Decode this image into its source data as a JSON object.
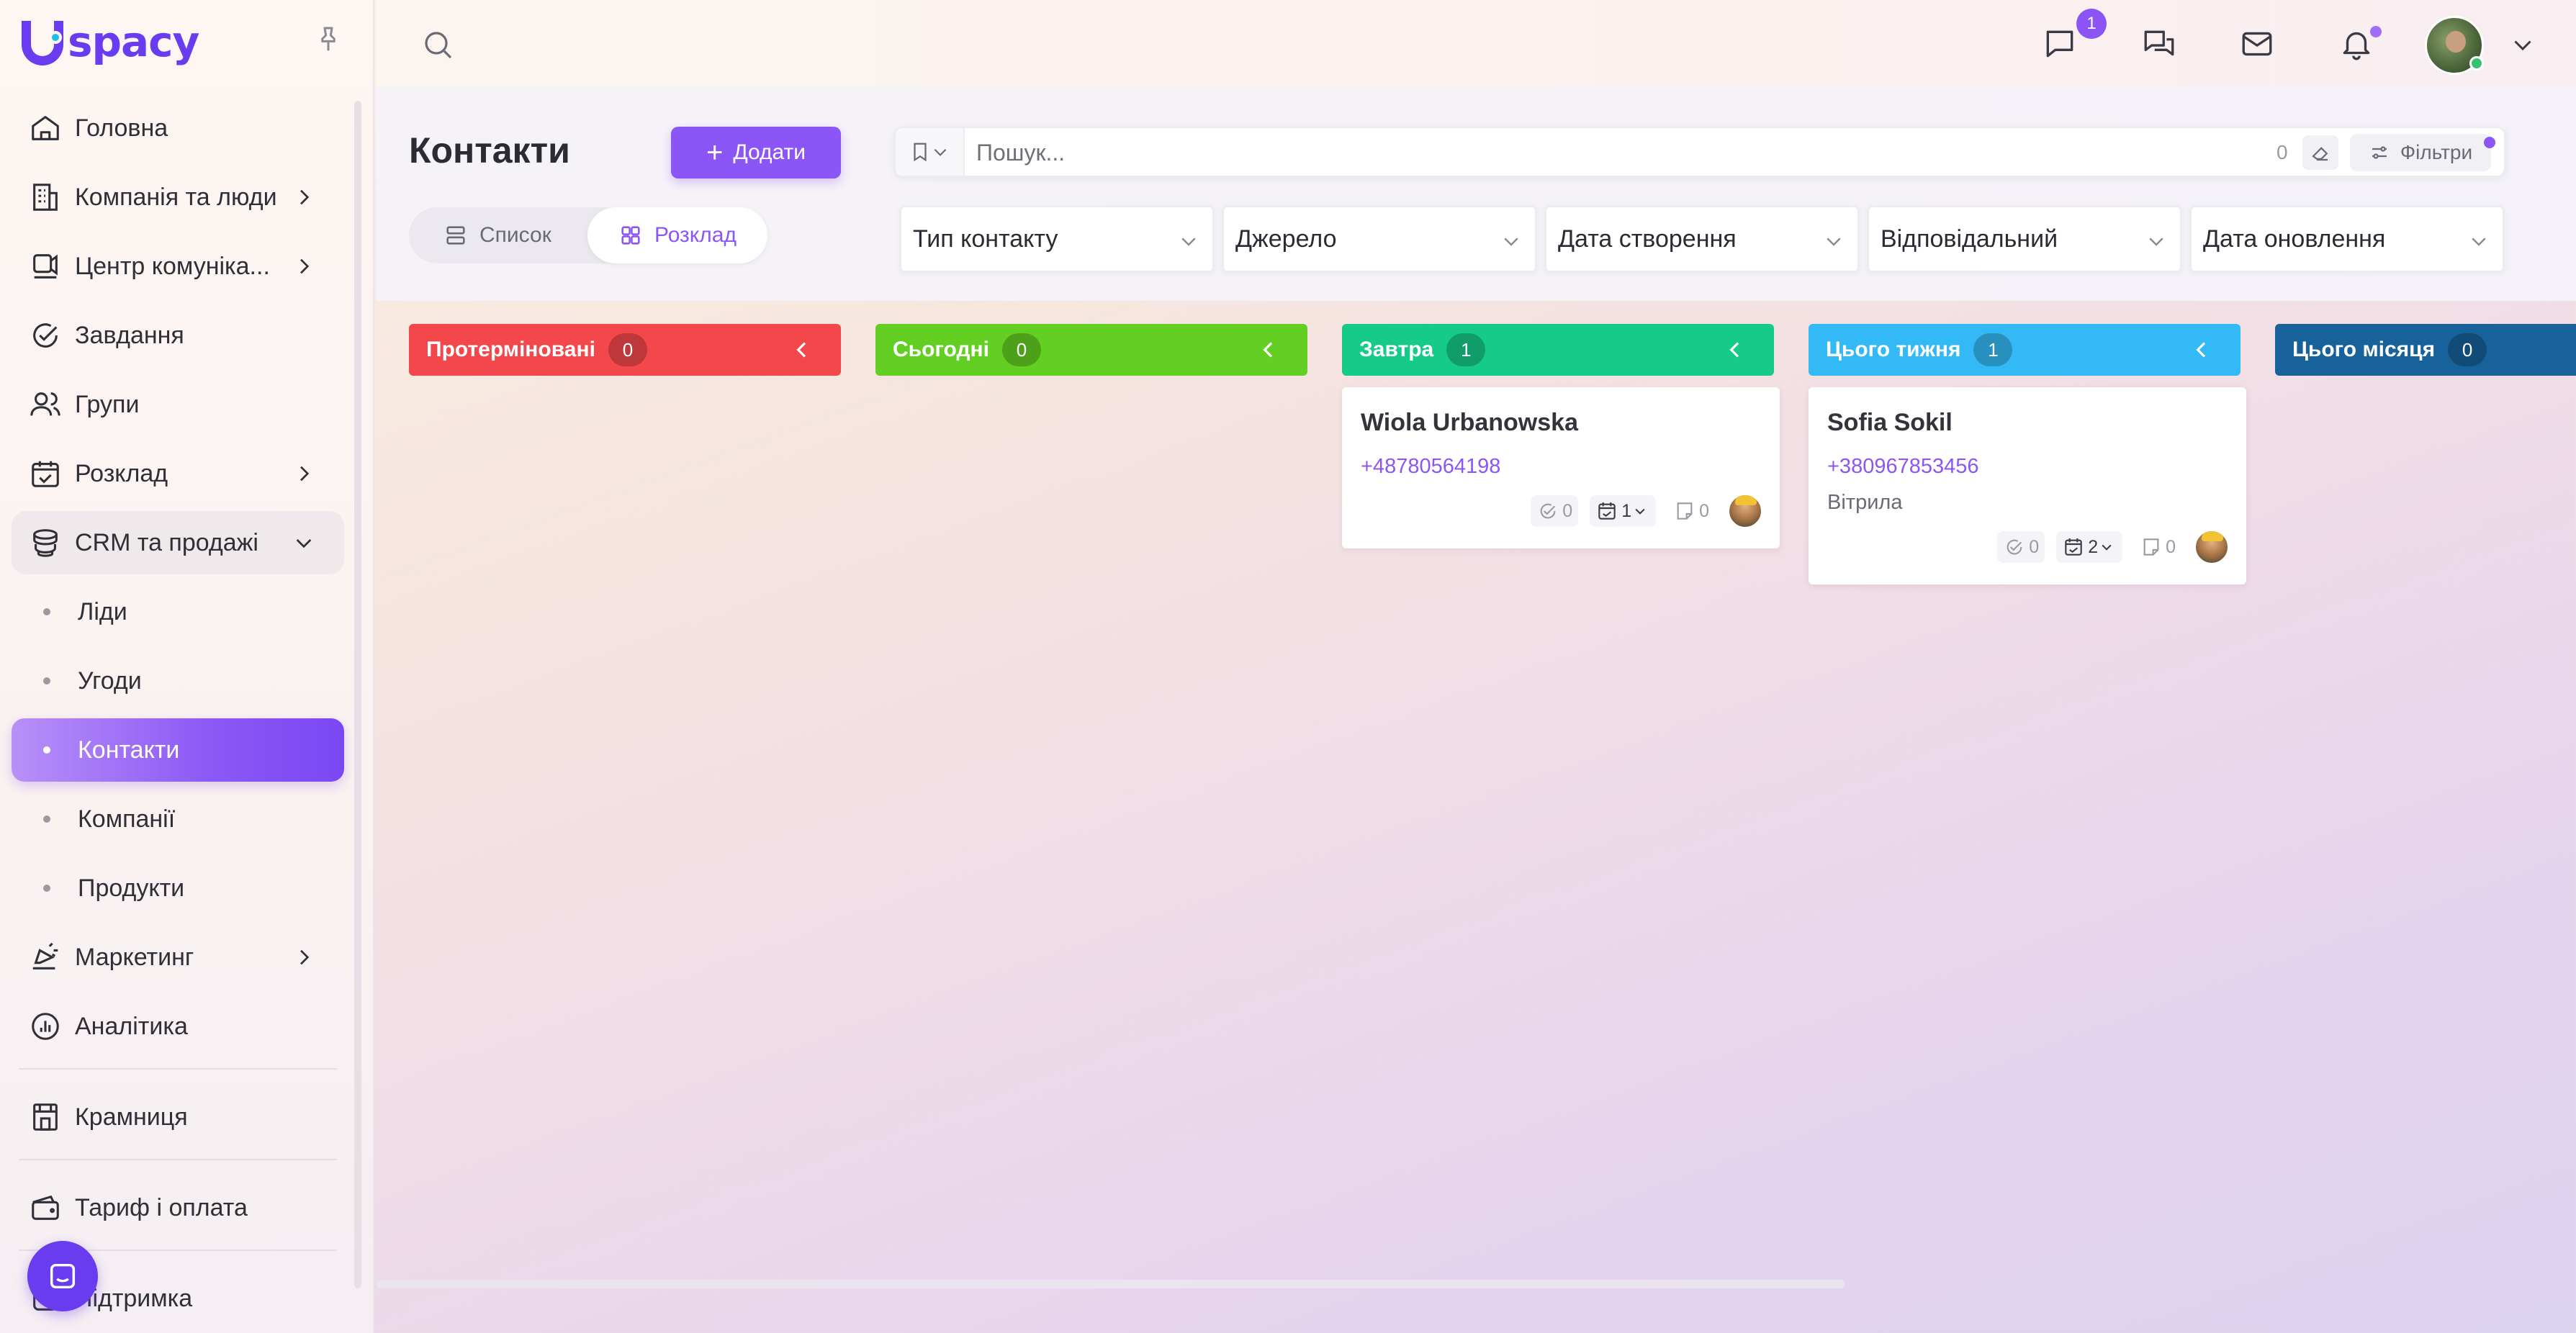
{
  "app": {
    "logo_text": "spacy"
  },
  "sidebar": {
    "items": [
      {
        "label": "Головна",
        "icon": "home-icon"
      },
      {
        "label": "Компанія та люди",
        "icon": "building-icon",
        "has_children": true
      },
      {
        "label": "Центр комуніка...",
        "icon": "share-icon",
        "has_children": true
      },
      {
        "label": "Завдання",
        "icon": "check-circle-icon"
      },
      {
        "label": "Групи",
        "icon": "users-icon"
      },
      {
        "label": "Розклад",
        "icon": "calendar-check-icon",
        "has_children": true
      },
      {
        "label": "CRM та продажі",
        "icon": "coins-icon",
        "expanded": true
      }
    ],
    "crm_sub": [
      {
        "label": "Ліди"
      },
      {
        "label": "Угоди"
      },
      {
        "label": "Контакти",
        "active": true
      },
      {
        "label": "Компанії"
      },
      {
        "label": "Продукти"
      }
    ],
    "items_after": [
      {
        "label": "Маркетинг",
        "icon": "megaphone-icon",
        "has_children": true
      },
      {
        "label": "Аналітика",
        "icon": "chart-icon"
      }
    ],
    "store": {
      "label": "Крамниця",
      "icon": "store-icon"
    },
    "billing": {
      "label": "Тариф і оплата",
      "icon": "wallet-icon"
    },
    "support": {
      "label": "Підтримка",
      "icon": "support-icon"
    }
  },
  "topbar": {
    "chat_badge": "1"
  },
  "page": {
    "title": "Контакти",
    "add_label": "Додати",
    "view_list_label": "Список",
    "view_schedule_label": "Розклад",
    "search_placeholder": "Пошук...",
    "search_count": "0",
    "filters_label": "Фільтри",
    "filters": [
      "Тип контакту",
      "Джерело",
      "Дата створення",
      "Відповідальний",
      "Дата оновлення"
    ]
  },
  "columns": [
    {
      "title": "Протерміновані",
      "count": "0",
      "color": "#f4474c"
    },
    {
      "title": "Сьогодні",
      "count": "0",
      "color": "#63cf22"
    },
    {
      "title": "Завтра",
      "count": "1",
      "color": "#16ca8a"
    },
    {
      "title": "Цього тижня",
      "count": "1",
      "color": "#33b9f5"
    },
    {
      "title": "Цього місяця",
      "count": "0",
      "color": "#17629a"
    }
  ],
  "cards": [
    {
      "column": "Завтра",
      "name": "Wiola Urbanowska",
      "phone": "+48780564198",
      "source": "",
      "tasks": "0",
      "events": "1",
      "notes": "0"
    },
    {
      "column": "Цього тижня",
      "name": "Sofia Sokil",
      "phone": "+380967853456",
      "source": "Вітрила",
      "tasks": "0",
      "events": "2",
      "notes": "0"
    }
  ]
}
